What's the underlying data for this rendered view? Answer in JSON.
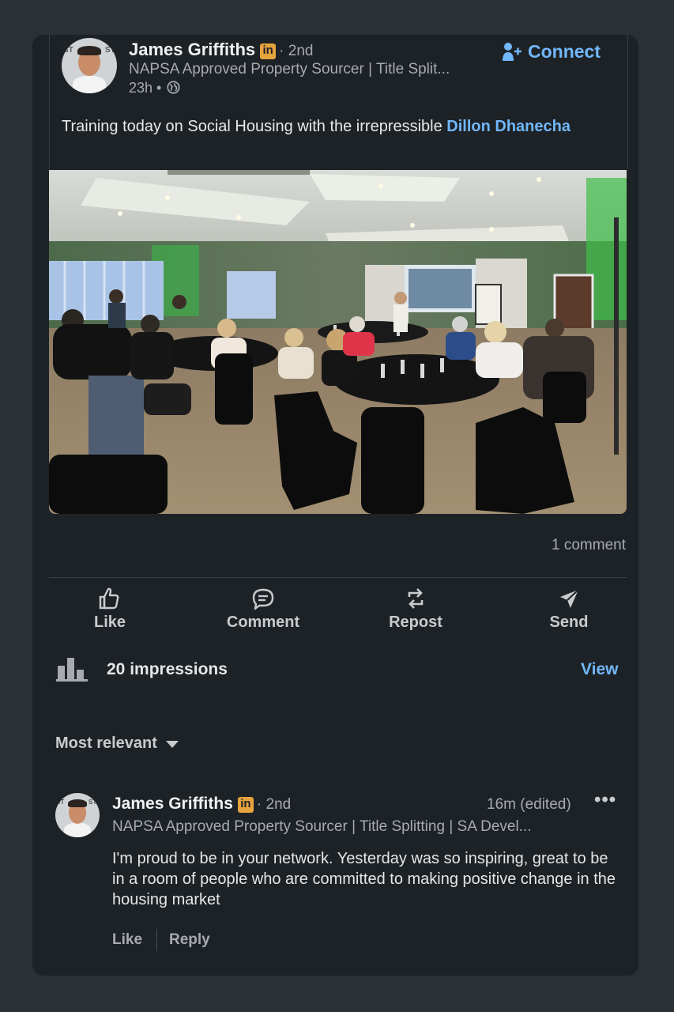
{
  "post": {
    "author": {
      "name": "James Griffiths",
      "badge": "in",
      "degree": "· 2nd",
      "headline": "NAPSA Approved Property Sourcer | Title Split...",
      "time": "23h •",
      "visibility_icon": "globe-icon"
    },
    "connect_label": "Connect",
    "text_before": "Training today on Social Housing with the irrepressible ",
    "mention": "Dillon Dhanecha",
    "image_description_icon": "conference-photo",
    "comment_count": "1 comment"
  },
  "actions": {
    "like": "Like",
    "comment": "Comment",
    "repost": "Repost",
    "send": "Send"
  },
  "impressions": {
    "label": "20 impressions",
    "view": "View"
  },
  "sort": {
    "label": "Most relevant"
  },
  "comment": {
    "author": "James Griffiths",
    "badge": "in",
    "degree": "· 2nd",
    "time": "16m (edited)",
    "more": "•••",
    "headline": "NAPSA Approved Property Sourcer | Title Splitting | SA Devel...",
    "text": "I'm proud to be in your network.  Yesterday was so inspiring, great to be in a room of people who are committed to making positive change in the housing market",
    "like": "Like",
    "reply": "Reply"
  },
  "colors": {
    "background": "#2b2f36",
    "card": "#1d2226",
    "link": "#71b7fb",
    "badge": "#e7a33e"
  }
}
